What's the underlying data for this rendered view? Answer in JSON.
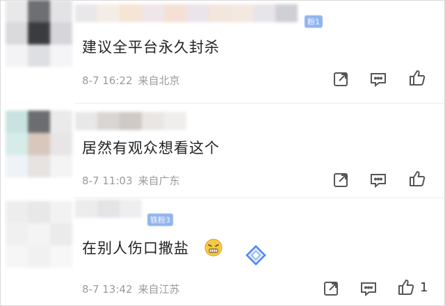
{
  "comments": [
    {
      "badge": "粉1",
      "text": "建议全平台永久封杀",
      "date": "8-7 16:22",
      "location": "来自北京",
      "like_count": ""
    },
    {
      "badge": "",
      "text": "居然有观众想看这个",
      "date": "8-7 11:03",
      "location": "来自广东",
      "like_count": ""
    },
    {
      "badge": "铁粉3",
      "text": "在别人伤口撒盐",
      "date": "8-7 13:42",
      "location": "来自江苏",
      "like_count": "1"
    }
  ],
  "icons": {
    "share": "share-icon",
    "reply": "comment-icon",
    "like": "thumbs-up-icon",
    "emoji": "grimace-emoji-icon",
    "sticker": "diamond-sticker-icon"
  },
  "colors": {
    "text": "#222222",
    "meta": "#9a9a9a",
    "icon": "#555555",
    "badge": "#8fb4ef"
  }
}
